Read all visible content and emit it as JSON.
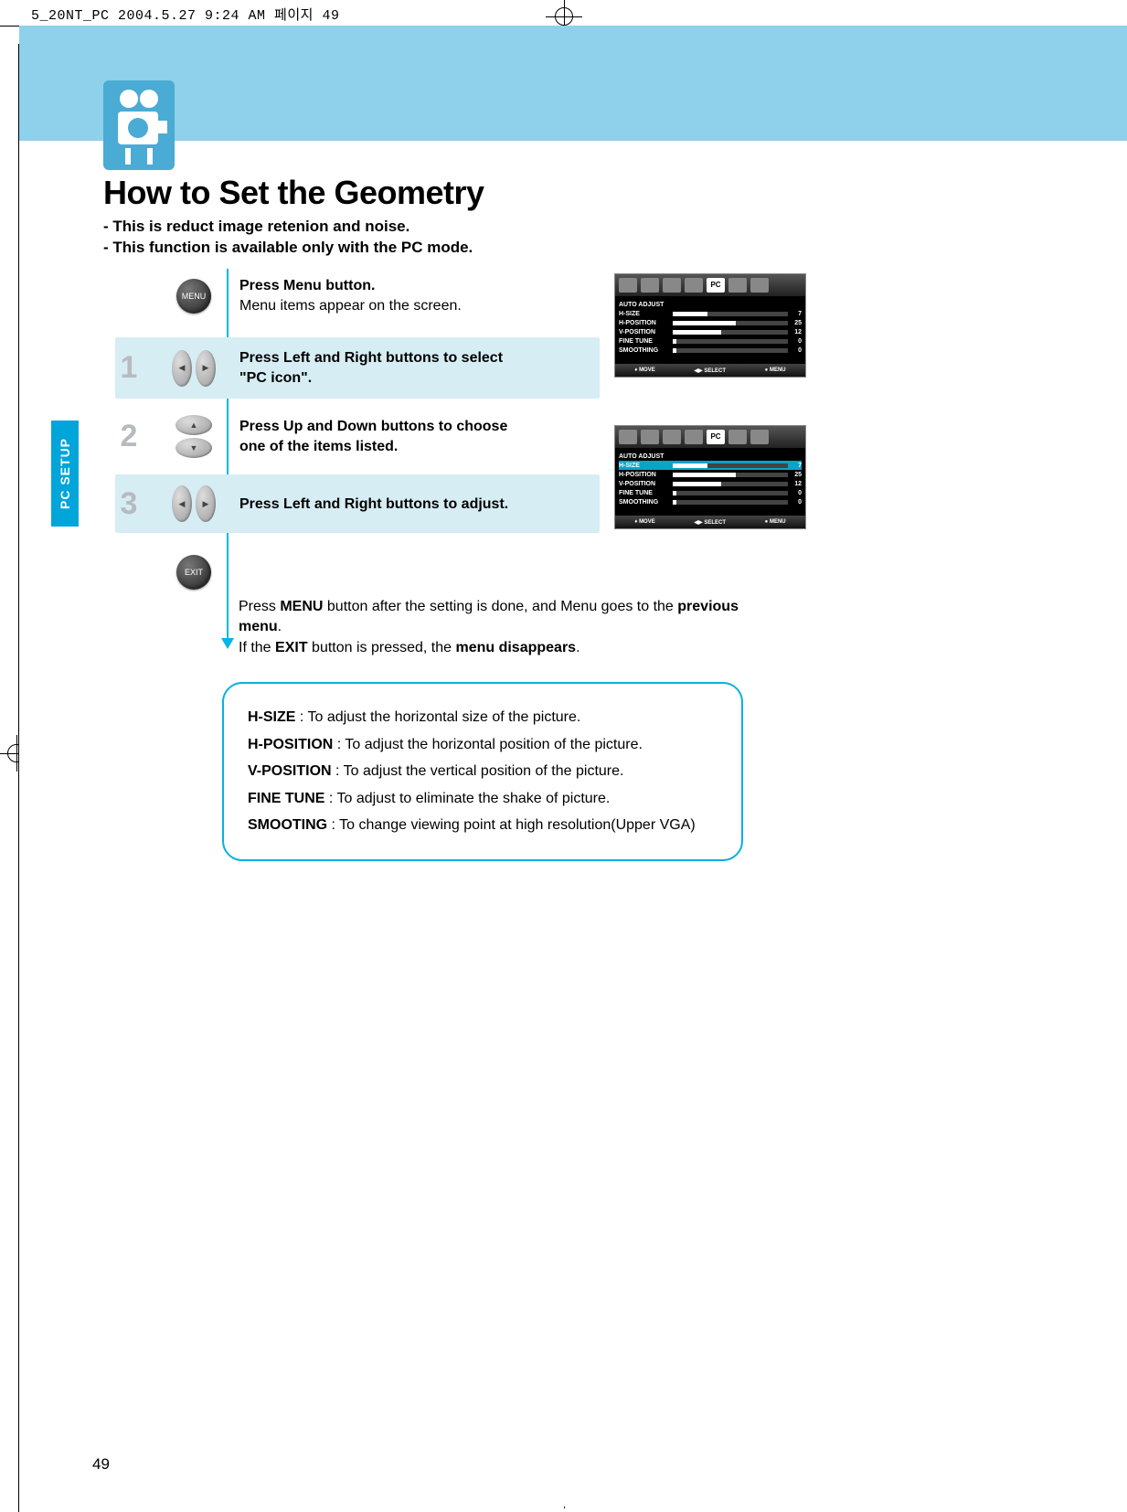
{
  "crop_header": "5_20NT_PC  2004.5.27 9:24 AM  페이지 49",
  "title": "How to Set the Geometry",
  "subtitle_lines": [
    "- This is reduct image retenion and noise.",
    "- This function is available only with the PC mode."
  ],
  "side_tab": "PC SETUP",
  "buttons": {
    "menu": "MENU",
    "exit": "EXIT"
  },
  "step_menu": {
    "bold": "Press Menu button.",
    "plain": "Menu items appear on the screen."
  },
  "step1": {
    "num": "1",
    "bold": "Press Left and Right buttons to select",
    "bold2": "\"PC icon\"."
  },
  "step2": {
    "num": "2",
    "bold": "Press Up and Down buttons to choose",
    "bold2": "one of the items listed."
  },
  "step3": {
    "num": "3",
    "bold": "Press Left and Right buttons to adjust."
  },
  "footer": {
    "p1a": "Press ",
    "p1b": "MENU",
    "p1c": " button after the setting is done, and Menu goes to the ",
    "p1d": "previous menu",
    "p1e": ".",
    "p2a": "If the ",
    "p2b": "EXIT",
    "p2c": " button is pressed, the ",
    "p2d": "menu disappears",
    "p2e": "."
  },
  "info": [
    {
      "k": "H-SIZE",
      "v": " : To adjust the horizontal size of the picture."
    },
    {
      "k": "H-POSITION",
      "v": " : To adjust the horizontal position of the picture."
    },
    {
      "k": "V-POSITION",
      "v": " : To adjust the vertical position of the picture."
    },
    {
      "k": "FINE TUNE",
      "v": " : To adjust to eliminate the shake of picture."
    },
    {
      "k": "SMOOTING",
      "v": " : To change viewing point at high resolution(Upper VGA)"
    }
  ],
  "page_num": "49",
  "osd": {
    "pc_badge": "PC",
    "items": [
      {
        "label": "AUTO ADJUST",
        "val": "",
        "pct": 0,
        "nobar": true
      },
      {
        "label": "H-SIZE",
        "val": "7",
        "pct": 30
      },
      {
        "label": "H-POSITION",
        "val": "25",
        "pct": 55
      },
      {
        "label": "V-POSITION",
        "val": "12",
        "pct": 42
      },
      {
        "label": "FINE TUNE",
        "val": "0",
        "pct": 3
      },
      {
        "label": "SMOOTHING",
        "val": "0",
        "pct": 3
      }
    ],
    "selected_index_osd2": 1,
    "foot": {
      "move": "MOVE",
      "select": "SELECT",
      "menu": "MENU"
    }
  }
}
